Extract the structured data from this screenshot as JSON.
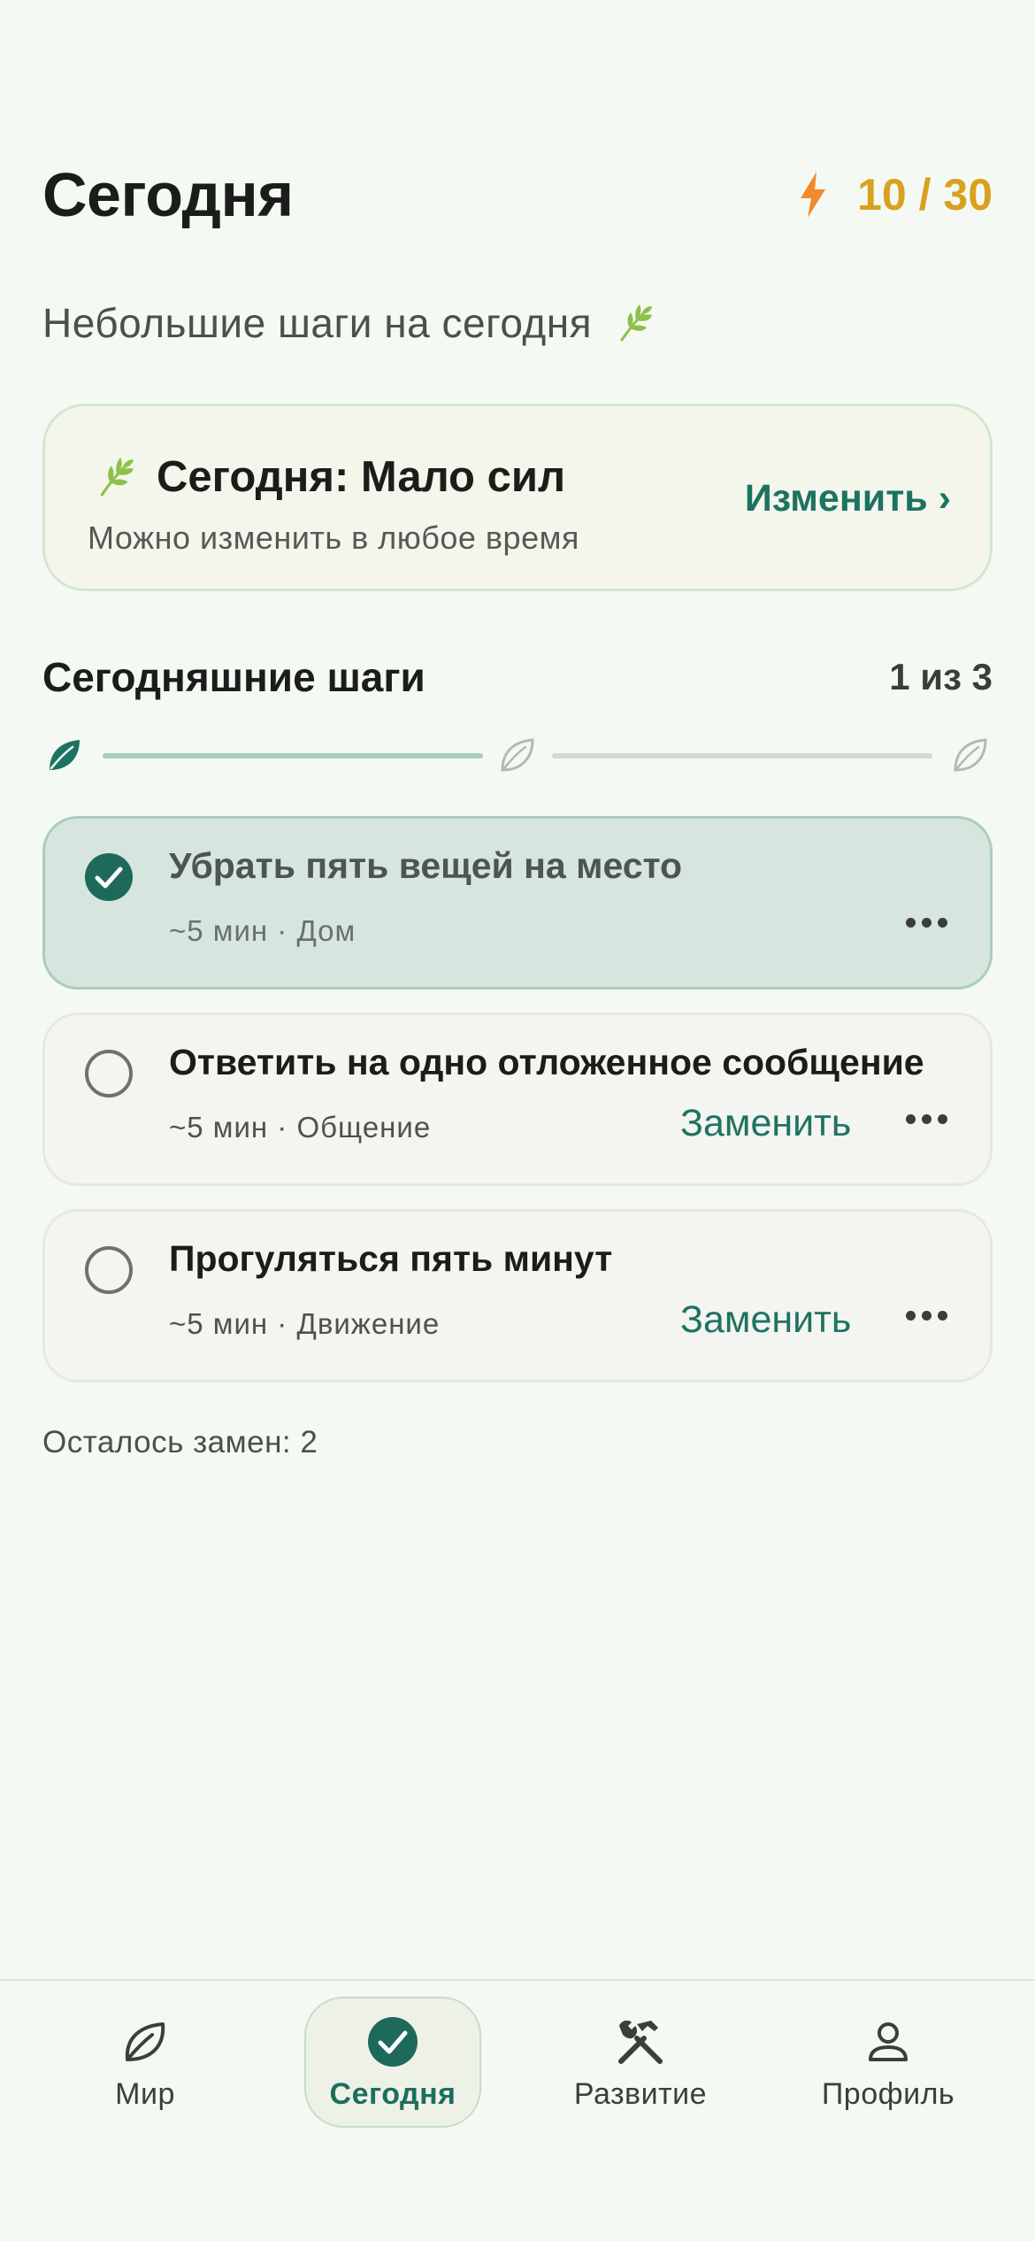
{
  "header": {
    "title": "Сегодня",
    "energy_value": "10 / 30"
  },
  "subtitle": "Небольшие шаги на сегодня",
  "mode_card": {
    "title": "Сегодня: Мало сил",
    "hint": "Можно изменить в любое время",
    "change_label": "Изменить ›"
  },
  "steps": {
    "title": "Сегодняшние шаги",
    "count": "1 из 3",
    "progress": 0.3333,
    "items": [
      {
        "title": "Убрать пять вещей на место",
        "meta": "~5 мин · Дом",
        "done": true,
        "replace_label": ""
      },
      {
        "title": "Ответить на одно отложенное сообщение",
        "meta": "~5 мин · Общение",
        "done": false,
        "replace_label": "Заменить"
      },
      {
        "title": "Прогуляться пять минут",
        "meta": "~5 мин · Движение",
        "done": false,
        "replace_label": "Заменить"
      }
    ]
  },
  "remaining": "Осталось замен: 2",
  "nav": {
    "items": [
      {
        "label": "Мир",
        "icon": "leaf-icon",
        "active": false
      },
      {
        "label": "Сегодня",
        "icon": "check-circle-icon",
        "active": true
      },
      {
        "label": "Развитие",
        "icon": "tools-icon",
        "active": false
      },
      {
        "label": "Профиль",
        "icon": "person-icon",
        "active": false
      }
    ]
  },
  "colors": {
    "accent": "#1d7361",
    "energy": "#d9a11f",
    "bolt": "#f08a2c",
    "background": "#f5f9f3",
    "done_card": "#d6e6de"
  }
}
